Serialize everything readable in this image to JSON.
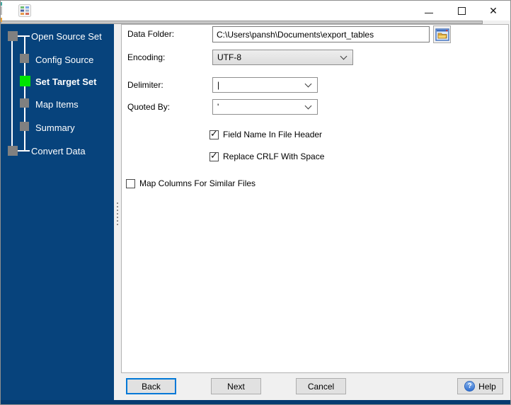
{
  "titlebar": {
    "title": "",
    "close_glyph": "✕"
  },
  "icons": {
    "check": "✓",
    "help": "?",
    "app_icon": "table-grid-icon",
    "browse": "open-folder-icon"
  },
  "colors": {
    "sidebar_bg": "#07437C",
    "active_step_green": "#00E400",
    "inactive_step_gray": "#808080",
    "focus_accent": "#0078D7",
    "bottom_strip": "#053B70"
  },
  "sidebar": {
    "items": [
      {
        "label": "Open Source Set",
        "active": false
      },
      {
        "label": "Config Source",
        "active": false
      },
      {
        "label": "Set Target Set",
        "active": true
      },
      {
        "label": "Map Items",
        "active": false
      },
      {
        "label": "Summary",
        "active": false
      },
      {
        "label": "Convert Data",
        "active": false
      }
    ]
  },
  "form": {
    "data_folder": {
      "label": "Data Folder:",
      "value": "C:\\Users\\pansh\\Documents\\export_tables"
    },
    "encoding": {
      "label": "Encoding:",
      "value": "UTF-8"
    },
    "delimiter": {
      "label": "Delimiter:",
      "value": "|"
    },
    "quoted_by": {
      "label": "Quoted By:",
      "value": "'"
    },
    "checkboxes": [
      {
        "label": "Field Name In File Header",
        "checked": true
      },
      {
        "label": "Replace CRLF With Space",
        "checked": true
      },
      {
        "label": "Map Columns For Similar Files",
        "checked": false
      }
    ]
  },
  "buttons": {
    "back": "Back",
    "next": "Next",
    "cancel": "Cancel",
    "help": "Help"
  }
}
